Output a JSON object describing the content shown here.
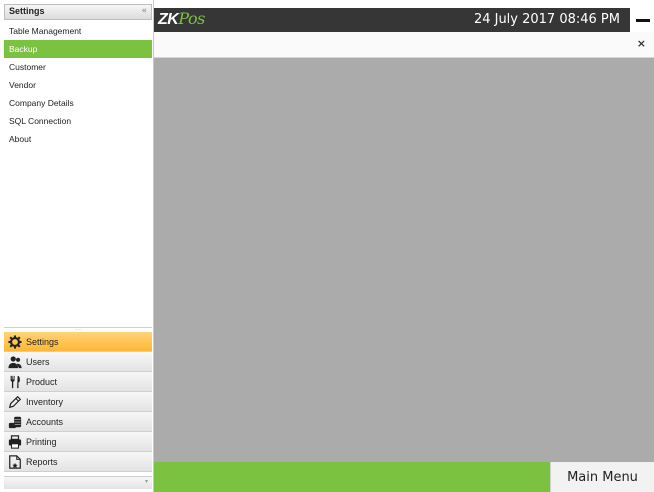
{
  "sidebar": {
    "title": "Settings",
    "collapse_glyph": "«",
    "items": [
      {
        "label": "Table Management",
        "active": false
      },
      {
        "label": "Backup",
        "active": true
      },
      {
        "label": "Customer",
        "active": false
      },
      {
        "label": "Vendor",
        "active": false
      },
      {
        "label": "Company Details",
        "active": false
      },
      {
        "label": "SQL Connection",
        "active": false
      },
      {
        "label": "About",
        "active": false
      }
    ],
    "modules": [
      {
        "label": "Settings",
        "icon": "gear-icon",
        "active": true
      },
      {
        "label": "Users",
        "icon": "users-icon",
        "active": false
      },
      {
        "label": "Product",
        "icon": "fork-knife-icon",
        "active": false
      },
      {
        "label": "Inventory",
        "icon": "pencil-ruler-icon",
        "active": false
      },
      {
        "label": "Accounts",
        "icon": "coins-icon",
        "active": false
      },
      {
        "label": "Printing",
        "icon": "printer-icon",
        "active": false
      },
      {
        "label": "Reports",
        "icon": "report-icon",
        "active": false
      }
    ]
  },
  "header": {
    "logo_main": "ZK",
    "logo_accent": "Pos",
    "datetime": "24 July 2017 08:46 PM"
  },
  "tab": {
    "close_glyph": "×"
  },
  "footer": {
    "main_menu_label": "Main Menu"
  },
  "colors": {
    "accent_green": "#7cc241",
    "active_orange": "#ffb733",
    "topbar_dark": "#363636",
    "content_gray": "#ababab"
  }
}
